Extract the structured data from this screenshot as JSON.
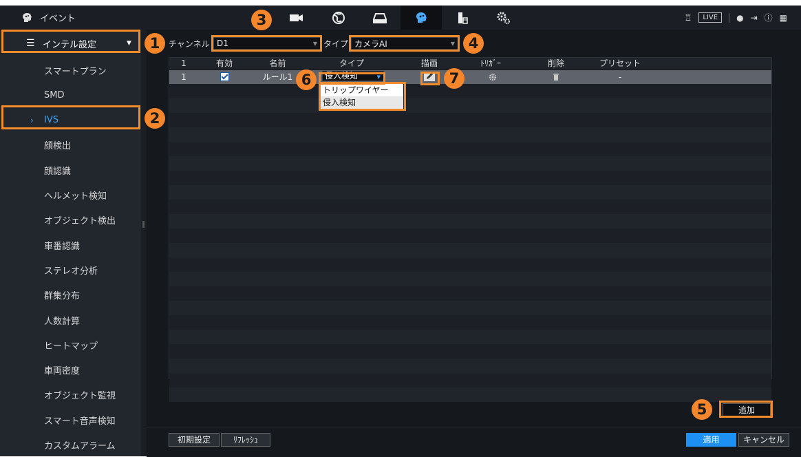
{
  "app": {
    "title": "イベント"
  },
  "topnav": {
    "icons": [
      "camera-icon",
      "network-globe-icon",
      "storage-icon",
      "brain-ai-icon",
      "device-icon",
      "settings-gears-icon"
    ],
    "active_index": 3
  },
  "topright": {
    "live": "LIVE"
  },
  "sidebar": {
    "header": "インテル設定",
    "items": [
      {
        "label": "スマートプラン"
      },
      {
        "label": "SMD"
      },
      {
        "label": "IVS",
        "active": true
      },
      {
        "label": "顔検出"
      },
      {
        "label": "顔認識"
      },
      {
        "label": "ヘルメット検知"
      },
      {
        "label": "オブジェクト検出"
      },
      {
        "label": "車番認識"
      },
      {
        "label": "ステレオ分析"
      },
      {
        "label": "群集分布"
      },
      {
        "label": "人数計算"
      },
      {
        "label": "ヒートマップ"
      },
      {
        "label": "車両密度"
      },
      {
        "label": "オブジェクト監視"
      },
      {
        "label": "スマート音声検知"
      },
      {
        "label": "カスタムアラーム"
      }
    ]
  },
  "filter": {
    "channel_label": "チャンネル",
    "channel_value": "D1",
    "type_label": "タイプ",
    "type_value": "カメラAI"
  },
  "table": {
    "headers": {
      "num": "1",
      "enable": "有効",
      "name": "名前",
      "type": "タイプ",
      "draw": "描画",
      "trigger": "ﾄﾘｶﾞｰ",
      "delete": "削除",
      "preset": "プリセット"
    },
    "rows": [
      {
        "num": "1",
        "enabled": true,
        "name": "ルール1",
        "type": "侵入検知",
        "preset": "-"
      }
    ]
  },
  "type_dropdown": {
    "options": [
      "トリップワイヤー",
      "侵入検知"
    ]
  },
  "buttons": {
    "add": "追加",
    "default": "初期設定",
    "refresh": "ﾘﾌﾚｯｼｭ",
    "apply": "適用",
    "cancel": "キャンセル"
  },
  "badges": [
    "1",
    "2",
    "3",
    "4",
    "5",
    "6",
    "7"
  ],
  "colors": {
    "accent": "#1e8ff3",
    "highlight": "#f08a2a",
    "active_text": "#3aa7ff"
  }
}
